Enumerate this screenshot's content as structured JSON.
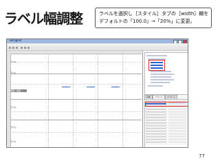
{
  "slide": {
    "title": "ラベル幅調整",
    "callout_lines": [
      "ラベルを選択し［スタイル］タブの［width］欄を",
      "デフォルトの「100.0」→「20%」に変更。"
    ],
    "page_number": "77"
  },
  "screenshot": {
    "window_title": "Designer",
    "labels": [
      "ラベル",
      "ラベル",
      "明細・帳票",
      "ラベル",
      "ラベル",
      "ラベル"
    ],
    "panel_tabs": [
      "基本",
      "スタイル",
      "イベント"
    ],
    "highlight_color": "#e02020",
    "selection_color": "#2a5fd0"
  }
}
